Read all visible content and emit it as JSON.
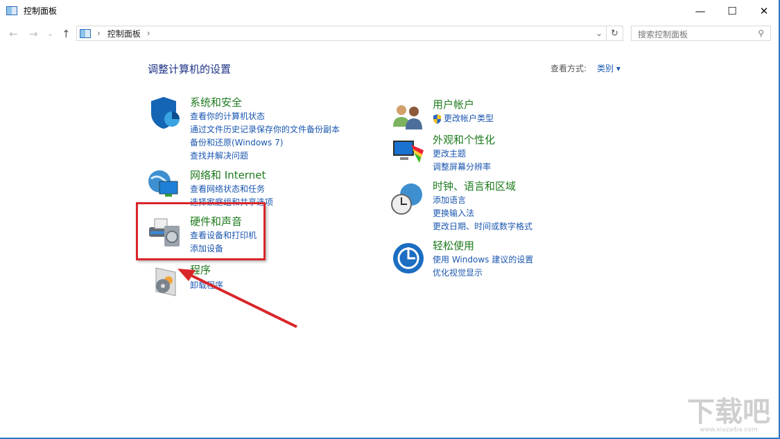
{
  "window": {
    "title": "控制面板",
    "minimize": "—",
    "maximize": "☐",
    "close": "✕"
  },
  "nav": {
    "back": "←",
    "forward": "→",
    "recent": "⌄",
    "up": "↑",
    "refresh": "↻",
    "dropdown": "⌄"
  },
  "address": {
    "sep1": "›",
    "crumb": "控制面板",
    "sep2": "›"
  },
  "search": {
    "placeholder": "搜索控制面板",
    "icon": "⚲"
  },
  "page": {
    "heading": "调整计算机的设置",
    "view_by_label": "查看方式:",
    "view_by_value": "类别 ▾"
  },
  "left": [
    {
      "title": "系统和安全",
      "links": [
        "查看你的计算机状态",
        "通过文件历史记录保存你的文件备份副本",
        "备份和还原(Windows 7)",
        "查找并解决问题"
      ]
    },
    {
      "title": "网络和 Internet",
      "links": [
        "查看网络状态和任务",
        "选择家庭组和共享选项"
      ]
    },
    {
      "title": "硬件和声音",
      "links": [
        "查看设备和打印机",
        "添加设备"
      ]
    },
    {
      "title": "程序",
      "links": [
        "卸载程序"
      ]
    }
  ],
  "right": [
    {
      "title": "用户帐户",
      "links": [
        "更改帐户类型"
      ]
    },
    {
      "title": "外观和个性化",
      "links": [
        "更改主题",
        "调整屏幕分辨率"
      ]
    },
    {
      "title": "时钟、语言和区域",
      "links": [
        "添加语言",
        "更换输入法",
        "更改日期、时间或数字格式"
      ]
    },
    {
      "title": "轻松使用",
      "links": [
        "使用 Windows 建议的设置",
        "优化视觉显示"
      ]
    }
  ],
  "watermark": {
    "logo": "下载吧",
    "url": "www.xiazaiba.com"
  }
}
